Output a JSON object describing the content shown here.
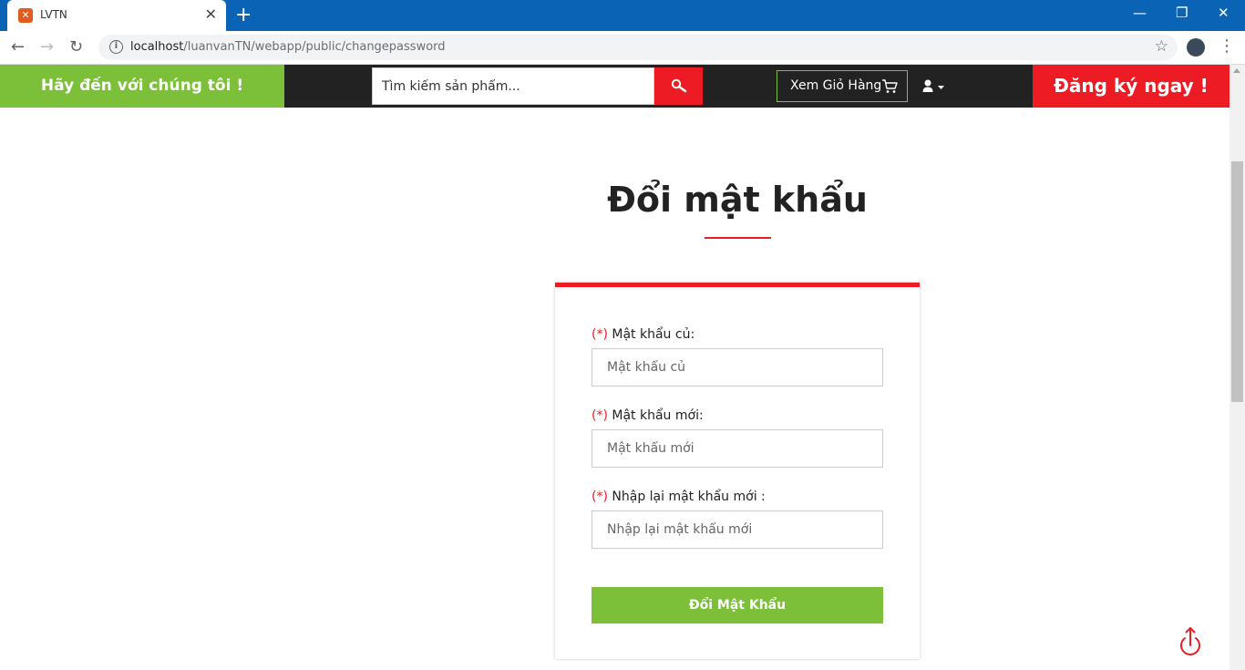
{
  "browser": {
    "tab_title": "LVTN",
    "tab_favicon": "XAMPP",
    "new_tab_label": "+",
    "tab_close_label": "✕",
    "url_host": "localhost",
    "url_path": "/luanvanTN/webapp/public/changepassword"
  },
  "header": {
    "welcome_text": "Hãy đến với chúng tôi !",
    "search_placeholder": "Tìm kiếm sản phẩm...",
    "cart_label": "Xem Giỏ Hàng",
    "register_label": "Đăng ký ngay !"
  },
  "form": {
    "title": "Đổi mật khẩu",
    "required_mark": "(*)",
    "old_password_label": "Mật khẩu củ:",
    "old_password_placeholder": "Mật khẩu củ",
    "new_password_label": "Mật khẩu mới:",
    "new_password_placeholder": "Mật khẩu mới",
    "confirm_password_label": "Nhập lại mật khẩu mới :",
    "confirm_password_placeholder": "Nhập lại mật khẩu mới",
    "submit_label": "Đổi Mật Khẩu"
  },
  "colors": {
    "accent_green": "#7cc03a",
    "accent_red": "#ed1c24",
    "header_dark": "#222222",
    "chrome_blue": "#0b63b5"
  },
  "icons": [
    "search-icon",
    "cart-icon",
    "user-icon",
    "back-to-top-icon",
    "star-icon",
    "info-icon"
  ]
}
